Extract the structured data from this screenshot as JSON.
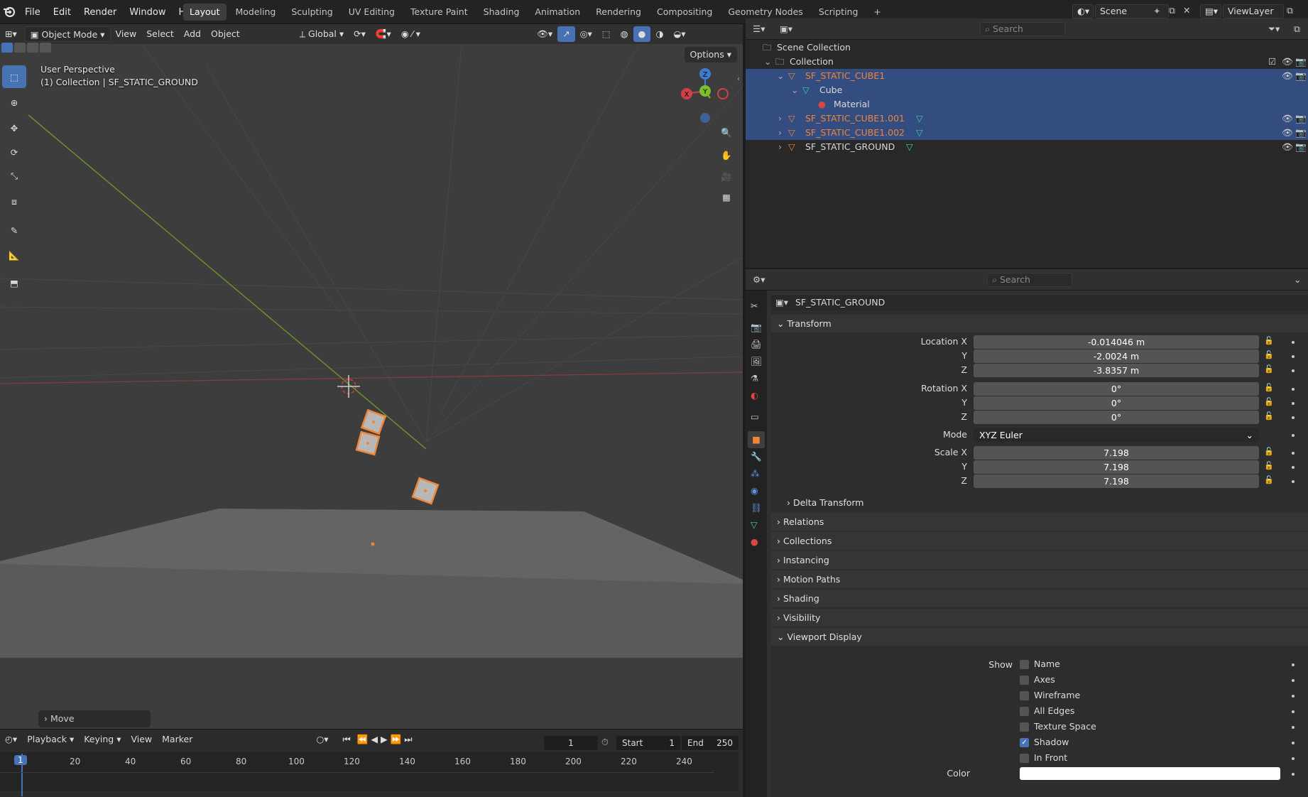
{
  "menubar": {
    "items": [
      "File",
      "Edit",
      "Render",
      "Window",
      "Help"
    ],
    "workspaces": [
      "Layout",
      "Modeling",
      "Sculpting",
      "UV Editing",
      "Texture Paint",
      "Shading",
      "Animation",
      "Rendering",
      "Compositing",
      "Geometry Nodes",
      "Scripting"
    ],
    "active_workspace": "Layout",
    "add_tab": "+",
    "scene": "Scene",
    "view_layer": "ViewLayer"
  },
  "viewport": {
    "mode": "Object Mode",
    "menus": [
      "View",
      "Select",
      "Add",
      "Object"
    ],
    "orientation": "Global",
    "options_label": "Options",
    "perspective": "User Perspective",
    "context": "(1) Collection | SF_STATIC_GROUND",
    "gizmo": {
      "x": "X",
      "y": "Y",
      "z": "Z"
    },
    "last_operator": "Move"
  },
  "outliner": {
    "search_placeholder": "Search",
    "scene_collection": "Scene Collection",
    "collection": "Collection",
    "rows": [
      {
        "label": "SF_STATIC_CUBE1",
        "selected": true
      },
      {
        "label": "Cube",
        "selected": true
      },
      {
        "label": "Material",
        "selected": true
      },
      {
        "label": "SF_STATIC_CUBE1.001",
        "selected": true
      },
      {
        "label": "SF_STATIC_CUBE1.002",
        "selected": true
      },
      {
        "label": "SF_STATIC_GROUND",
        "selected": false
      }
    ]
  },
  "properties": {
    "search_placeholder": "Search",
    "object_name": "SF_STATIC_GROUND",
    "transform": {
      "title": "Transform",
      "location_x_label": "Location X",
      "location_x": "-0.014046 m",
      "location_y": "-2.0024 m",
      "location_z": "-3.8357 m",
      "rotation_x_label": "Rotation X",
      "rotation_x": "0°",
      "rotation_y": "0°",
      "rotation_z": "0°",
      "mode_label": "Mode",
      "mode": "XYZ Euler",
      "scale_x_label": "Scale X",
      "scale_x": "7.198",
      "scale_y": "7.198",
      "scale_z": "7.198",
      "y_label": "Y",
      "z_label": "Z",
      "delta": "Delta Transform"
    },
    "sections": [
      "Relations",
      "Collections",
      "Instancing",
      "Motion Paths",
      "Shading",
      "Visibility"
    ],
    "viewport_display": {
      "title": "Viewport Display",
      "show_label": "Show",
      "options": [
        {
          "label": "Name",
          "checked": false
        },
        {
          "label": "Axes",
          "checked": false
        },
        {
          "label": "Wireframe",
          "checked": false
        },
        {
          "label": "All Edges",
          "checked": false
        },
        {
          "label": "Texture Space",
          "checked": false
        },
        {
          "label": "Shadow",
          "checked": true
        },
        {
          "label": "In Front",
          "checked": false
        }
      ],
      "color_label": "Color",
      "color_value": "#ffffff"
    }
  },
  "timeline": {
    "menus": [
      "Playback",
      "Keying",
      "View",
      "Marker"
    ],
    "current_frame": "1",
    "start_label": "Start",
    "start": "1",
    "end_label": "End",
    "end": "250",
    "ruler": [
      "1",
      "20",
      "40",
      "60",
      "80",
      "100",
      "120",
      "140",
      "160",
      "180",
      "200",
      "220",
      "240"
    ]
  },
  "colors": {
    "accent": "#4772b3",
    "selected_object": "#f08437",
    "outliner_selected_row": "#334d80"
  }
}
